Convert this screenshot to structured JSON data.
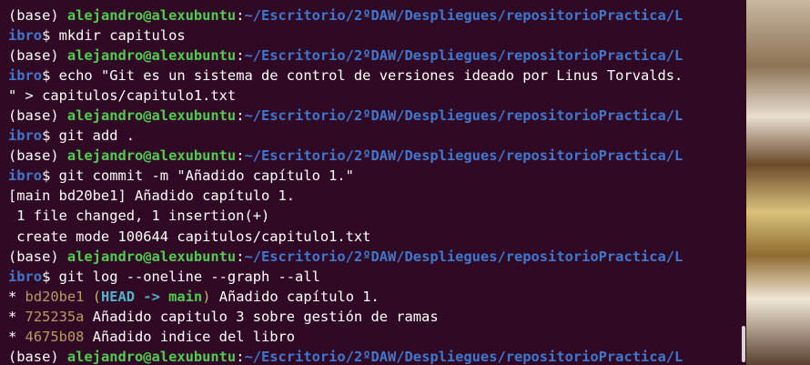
{
  "terminal": {
    "lines": [
      {
        "parts": [
          {
            "t": "(base) ",
            "c": "plain"
          },
          {
            "t": "alejandro@alexubuntu",
            "c": "user"
          },
          {
            "t": ":",
            "c": "plain"
          },
          {
            "t": "~/Escritorio/2ºDAW/Despliegues/repositorioPractica/L",
            "c": "path"
          }
        ]
      },
      {
        "parts": [
          {
            "t": "ibro",
            "c": "path"
          },
          {
            "t": "$ mkdir capitulos",
            "c": "plain"
          }
        ]
      },
      {
        "parts": [
          {
            "t": "(base) ",
            "c": "plain"
          },
          {
            "t": "alejandro@alexubuntu",
            "c": "user"
          },
          {
            "t": ":",
            "c": "plain"
          },
          {
            "t": "~/Escritorio/2ºDAW/Despliegues/repositorioPractica/L",
            "c": "path"
          }
        ]
      },
      {
        "parts": [
          {
            "t": "ibro",
            "c": "path"
          },
          {
            "t": "$ echo \"Git es un sistema de control de versiones ideado por Linus Torvalds.",
            "c": "plain"
          }
        ]
      },
      {
        "parts": [
          {
            "t": "\" > capitulos/capitulo1.txt",
            "c": "plain"
          }
        ]
      },
      {
        "parts": [
          {
            "t": "(base) ",
            "c": "plain"
          },
          {
            "t": "alejandro@alexubuntu",
            "c": "user"
          },
          {
            "t": ":",
            "c": "plain"
          },
          {
            "t": "~/Escritorio/2ºDAW/Despliegues/repositorioPractica/L",
            "c": "path"
          }
        ]
      },
      {
        "parts": [
          {
            "t": "ibro",
            "c": "path"
          },
          {
            "t": "$ git add .",
            "c": "plain"
          }
        ]
      },
      {
        "parts": [
          {
            "t": "(base) ",
            "c": "plain"
          },
          {
            "t": "alejandro@alexubuntu",
            "c": "user"
          },
          {
            "t": ":",
            "c": "plain"
          },
          {
            "t": "~/Escritorio/2ºDAW/Despliegues/repositorioPractica/L",
            "c": "path"
          }
        ]
      },
      {
        "parts": [
          {
            "t": "ibro",
            "c": "path"
          },
          {
            "t": "$ git commit -m \"Añadido capítulo 1.\"",
            "c": "plain"
          }
        ]
      },
      {
        "parts": [
          {
            "t": "[main bd20be1] Añadido capítulo 1.",
            "c": "plain"
          }
        ]
      },
      {
        "parts": [
          {
            "t": " 1 file changed, 1 insertion(+)",
            "c": "plain"
          }
        ]
      },
      {
        "parts": [
          {
            "t": " create mode 100644 capitulos/capitulo1.txt",
            "c": "plain"
          }
        ]
      },
      {
        "parts": [
          {
            "t": "(base) ",
            "c": "plain"
          },
          {
            "t": "alejandro@alexubuntu",
            "c": "user"
          },
          {
            "t": ":",
            "c": "plain"
          },
          {
            "t": "~/Escritorio/2ºDAW/Despliegues/repositorioPractica/L",
            "c": "path"
          }
        ]
      },
      {
        "parts": [
          {
            "t": "ibro",
            "c": "path"
          },
          {
            "t": "$ git log --oneline --graph --all",
            "c": "plain"
          }
        ]
      },
      {
        "parts": [
          {
            "t": "* ",
            "c": "plain"
          },
          {
            "t": "bd20be1",
            "c": "hash"
          },
          {
            "t": " (",
            "c": "deco"
          },
          {
            "t": "HEAD -> ",
            "c": "head"
          },
          {
            "t": "main",
            "c": "branch"
          },
          {
            "t": ")",
            "c": "deco"
          },
          {
            "t": " Añadido capítulo 1.",
            "c": "plain"
          }
        ]
      },
      {
        "parts": [
          {
            "t": "* ",
            "c": "plain"
          },
          {
            "t": "725235a",
            "c": "hash"
          },
          {
            "t": " Añadido capitulo 3 sobre gestión de ramas",
            "c": "plain"
          }
        ]
      },
      {
        "parts": [
          {
            "t": "* ",
            "c": "plain"
          },
          {
            "t": "4675b08",
            "c": "hash"
          },
          {
            "t": " Añadido indice del libro",
            "c": "plain"
          }
        ]
      },
      {
        "parts": [
          {
            "t": "(base) ",
            "c": "plain"
          },
          {
            "t": "alejandro@alexubuntu",
            "c": "user"
          },
          {
            "t": ":",
            "c": "plain"
          },
          {
            "t": "~/Escritorio/2ºDAW/Despliegues/repositorioPractica/L",
            "c": "path"
          }
        ]
      }
    ]
  },
  "colors": {
    "background": "#300a24",
    "user": "#4fcd4f",
    "path": "#3f78cf",
    "hash": "#b89b62",
    "head": "#4fb3c9",
    "text": "#ffffff"
  }
}
